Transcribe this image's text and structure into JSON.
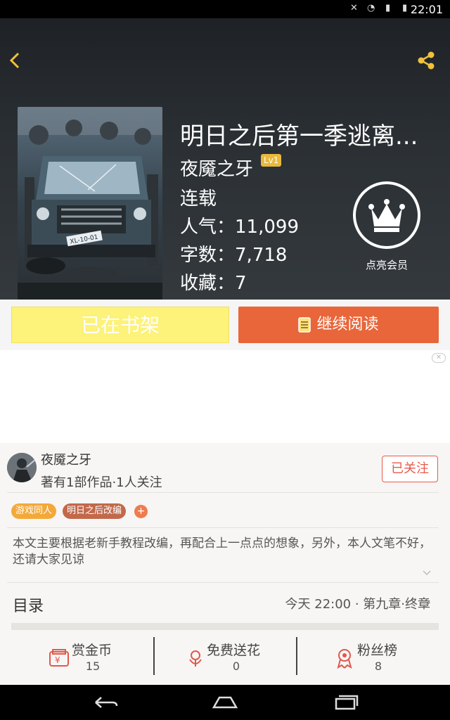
{
  "status_bar": {
    "time": "22:01"
  },
  "book": {
    "title": "明日之后第一季逃离...",
    "author": "夜魇之牙",
    "author_level": "Lv1",
    "status": "连载",
    "stats": [
      {
        "label": "人气：",
        "value": "11,099"
      },
      {
        "label": "字数：",
        "value": "7,718"
      },
      {
        "label": "收藏：",
        "value": "7"
      }
    ],
    "cover_plate": "XL-10-01"
  },
  "membership": {
    "label": "点亮会员"
  },
  "actions": {
    "on_shelf": "已在书架",
    "continue_reading": "继续阅读"
  },
  "author_info": {
    "name": "夜魇之牙",
    "works": "著有1部作品·1人关注",
    "follow_label": "已关注"
  },
  "tags": [
    {
      "label": "游戏同人",
      "color": "#f3a93a"
    },
    {
      "label": "明日之后改编",
      "color": "#c2694b"
    }
  ],
  "tag_add": "+",
  "description": "本文主要根据老新手教程改编，再配合上一点点的想象，另外，本人文笔不好，还请大家见谅",
  "toc": {
    "label": "目录",
    "latest": "今天 22:00 · 第九章·终章"
  },
  "bottom_stats": [
    {
      "label": "赏金币",
      "value": "15",
      "icon": "gold-coin-icon"
    },
    {
      "label": "免费送花",
      "value": "0",
      "icon": "flower-icon"
    },
    {
      "label": "粉丝榜",
      "value": "8",
      "icon": "ribbon-medal-icon"
    }
  ],
  "colors": {
    "accent": "#e8663a",
    "shelf": "#fdf27a",
    "level_badge": "#e8b93c",
    "follow": "#e85a4a"
  }
}
